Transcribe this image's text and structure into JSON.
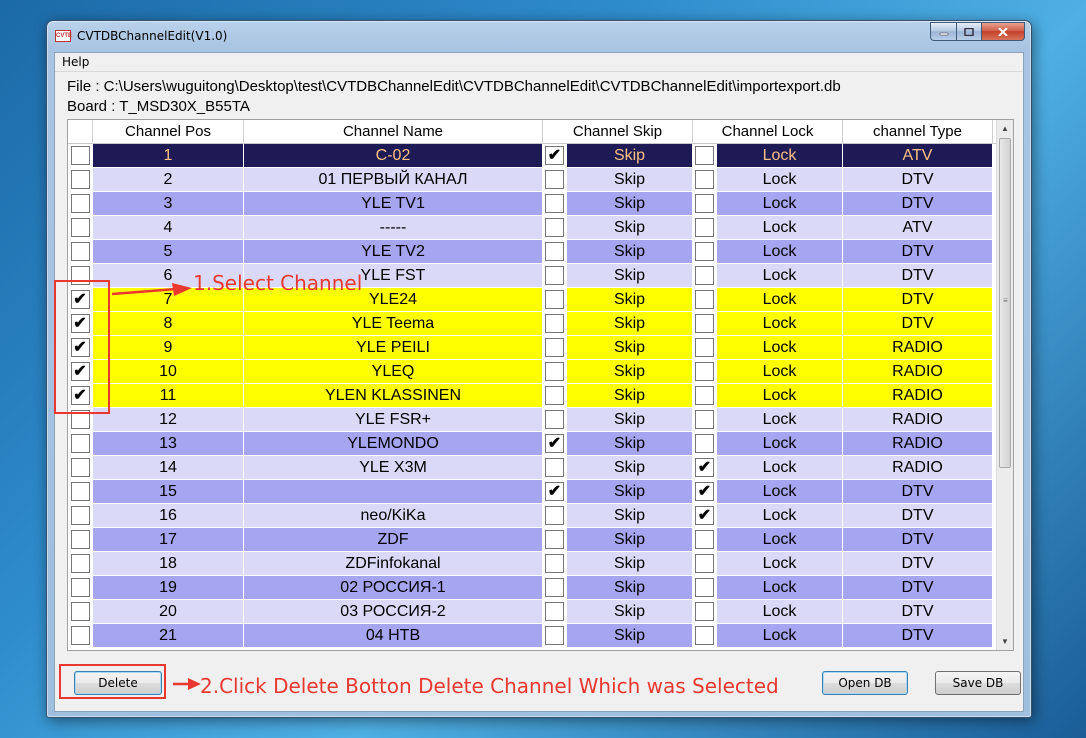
{
  "window": {
    "app_icon_text": "CVTE",
    "title": "CVTDBChannelEdit(V1.0)",
    "menu": [
      "Help"
    ]
  },
  "info": {
    "file": "File : C:\\Users\\wuguitong\\Desktop\\test\\CVTDBChannelEdit\\CVTDBChannelEdit\\CVTDBChannelEdit\\importexport.db",
    "board": "Board : T_MSD30X_B55TA"
  },
  "table": {
    "columns": [
      "Channel Pos",
      "Channel Name",
      "Channel Skip",
      "Channel Lock",
      "channel Type"
    ],
    "rows": [
      {
        "select": false,
        "pos": "1",
        "name": "C-02",
        "skip_checked": true,
        "skip": "Skip",
        "lock_checked": false,
        "lock": "Lock",
        "type": "ATV"
      },
      {
        "select": false,
        "pos": "2",
        "name": "01 ПЕРВЫЙ КАНАЛ",
        "skip_checked": false,
        "skip": "Skip",
        "lock_checked": false,
        "lock": "Lock",
        "type": "DTV"
      },
      {
        "select": false,
        "pos": "3",
        "name": "YLE TV1",
        "skip_checked": false,
        "skip": "Skip",
        "lock_checked": false,
        "lock": "Lock",
        "type": "DTV"
      },
      {
        "select": false,
        "pos": "4",
        "name": "-----",
        "skip_checked": false,
        "skip": "Skip",
        "lock_checked": false,
        "lock": "Lock",
        "type": "ATV"
      },
      {
        "select": false,
        "pos": "5",
        "name": "YLE TV2",
        "skip_checked": false,
        "skip": "Skip",
        "lock_checked": false,
        "lock": "Lock",
        "type": "DTV"
      },
      {
        "select": false,
        "pos": "6",
        "name": "YLE FST",
        "skip_checked": false,
        "skip": "Skip",
        "lock_checked": false,
        "lock": "Lock",
        "type": "DTV"
      },
      {
        "select": true,
        "pos": "7",
        "name": "YLE24",
        "skip_checked": false,
        "skip": "Skip",
        "lock_checked": false,
        "lock": "Lock",
        "type": "DTV"
      },
      {
        "select": true,
        "pos": "8",
        "name": "YLE Teema",
        "skip_checked": false,
        "skip": "Skip",
        "lock_checked": false,
        "lock": "Lock",
        "type": "DTV"
      },
      {
        "select": true,
        "pos": "9",
        "name": "YLE PEILI",
        "skip_checked": false,
        "skip": "Skip",
        "lock_checked": false,
        "lock": "Lock",
        "type": "RADIO"
      },
      {
        "select": true,
        "pos": "10",
        "name": "YLEQ",
        "skip_checked": false,
        "skip": "Skip",
        "lock_checked": false,
        "lock": "Lock",
        "type": "RADIO"
      },
      {
        "select": true,
        "pos": "11",
        "name": "YLEN KLASSINEN",
        "skip_checked": false,
        "skip": "Skip",
        "lock_checked": false,
        "lock": "Lock",
        "type": "RADIO"
      },
      {
        "select": false,
        "pos": "12",
        "name": "YLE FSR+",
        "skip_checked": false,
        "skip": "Skip",
        "lock_checked": false,
        "lock": "Lock",
        "type": "RADIO"
      },
      {
        "select": false,
        "pos": "13",
        "name": "YLEMONDO",
        "skip_checked": true,
        "skip": "Skip",
        "lock_checked": false,
        "lock": "Lock",
        "type": "RADIO"
      },
      {
        "select": false,
        "pos": "14",
        "name": "YLE X3M",
        "skip_checked": false,
        "skip": "Skip",
        "lock_checked": true,
        "lock": "Lock",
        "type": "RADIO"
      },
      {
        "select": false,
        "pos": "15",
        "name": "",
        "skip_checked": true,
        "skip": "Skip",
        "lock_checked": true,
        "lock": "Lock",
        "type": "DTV"
      },
      {
        "select": false,
        "pos": "16",
        "name": "neo/KiKa",
        "skip_checked": false,
        "skip": "Skip",
        "lock_checked": true,
        "lock": "Lock",
        "type": "DTV"
      },
      {
        "select": false,
        "pos": "17",
        "name": "ZDF",
        "skip_checked": false,
        "skip": "Skip",
        "lock_checked": false,
        "lock": "Lock",
        "type": "DTV"
      },
      {
        "select": false,
        "pos": "18",
        "name": "ZDFinfokanal",
        "skip_checked": false,
        "skip": "Skip",
        "lock_checked": false,
        "lock": "Lock",
        "type": "DTV"
      },
      {
        "select": false,
        "pos": "19",
        "name": "02 РОССИЯ-1",
        "skip_checked": false,
        "skip": "Skip",
        "lock_checked": false,
        "lock": "Lock",
        "type": "DTV"
      },
      {
        "select": false,
        "pos": "20",
        "name": "03 РОССИЯ-2",
        "skip_checked": false,
        "skip": "Skip",
        "lock_checked": false,
        "lock": "Lock",
        "type": "DTV"
      },
      {
        "select": false,
        "pos": "21",
        "name": "04 НТВ",
        "skip_checked": false,
        "skip": "Skip",
        "lock_checked": false,
        "lock": "Lock",
        "type": "DTV"
      }
    ]
  },
  "buttons": {
    "delete": "Delete",
    "open_db": "Open DB",
    "save_db": "Save DB"
  },
  "annotations": {
    "step1": "1.Select Channel",
    "step2": "2.Click Delete Botton Delete Channel Which was Selected",
    "color": "#e8382f"
  },
  "colors": {
    "row_current": "#1d1a55",
    "row_current_text": "#ffc080",
    "row_light": "#dadaf8",
    "row_dark": "#a6a6f0",
    "row_selected": "#ffff00"
  },
  "check_glyph": "✔"
}
